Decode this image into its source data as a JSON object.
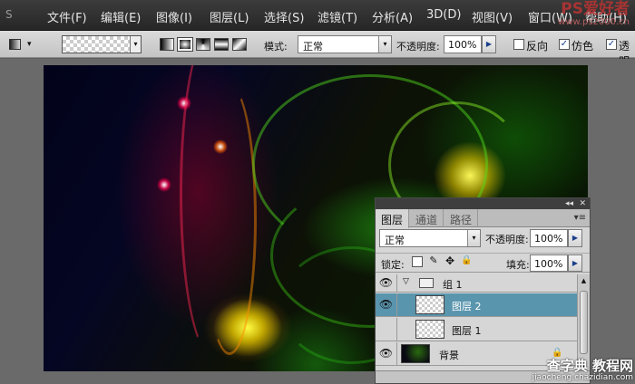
{
  "app": {
    "logo_text": "S"
  },
  "menu": {
    "items": [
      "文件(F)",
      "编辑(E)",
      "图像(I)",
      "图层(L)",
      "选择(S)",
      "滤镜(T)",
      "分析(A)",
      "3D(D)",
      "视图(V)",
      "窗口(W)",
      "帮助(H)"
    ]
  },
  "watermark": {
    "title": "PS爱好者",
    "url": "www.ps2000.cn"
  },
  "options": {
    "mode_label": "模式:",
    "mode_value": "正常",
    "opacity_label": "不透明度:",
    "opacity_value": "100%",
    "reverse_label": "反向",
    "dither_label": "仿色",
    "transparency_label": "透明",
    "reverse_checked": false,
    "dither_checked": true,
    "transparency_checked": true
  },
  "layers_panel": {
    "tabs": [
      "图层",
      "通道",
      "路径"
    ],
    "active_tab": "图层",
    "blend_mode": "正常",
    "opacity_label": "不透明度:",
    "opacity_value": "100%",
    "lock_label": "锁定:",
    "fill_label": "填充:",
    "fill_value": "100%",
    "layers": [
      {
        "name": "组 1",
        "type": "group",
        "visible": true,
        "selected": false
      },
      {
        "name": "图层 2",
        "type": "layer",
        "visible": true,
        "selected": true
      },
      {
        "name": "图层 1",
        "type": "layer",
        "visible": false,
        "selected": false
      },
      {
        "name": "背景",
        "type": "background",
        "visible": true,
        "selected": false,
        "locked": true
      }
    ]
  },
  "site_mark": {
    "title": "查字典 教程网",
    "url": "jiaocheng.chazidian.com"
  },
  "colors": {
    "selection": "#5a95ae",
    "menubar": "#2e2e2e",
    "panel": "#d6d6d6"
  }
}
